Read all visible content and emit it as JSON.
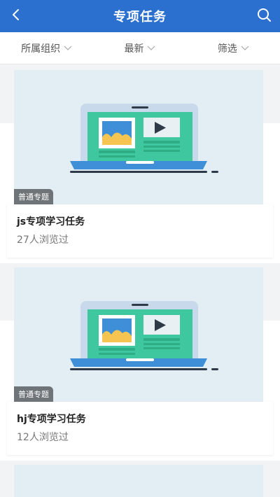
{
  "header": {
    "title": "专项任务",
    "back_icon": "chevron-left-icon",
    "search_icon": "search-icon",
    "bg": "#2b6fcf"
  },
  "filters": [
    {
      "label": "所属组织",
      "icon": "chevron-down-icon"
    },
    {
      "label": "最新",
      "icon": "chevron-down-icon"
    },
    {
      "label": "筛选",
      "icon": "chevron-down-icon"
    }
  ],
  "cards": [
    {
      "tag": "普通专题",
      "title": "js专项学习任务",
      "views": "27",
      "views_suffix": "人浏览过"
    },
    {
      "tag": "普通专题",
      "title": "hj专项学习任务",
      "views": "12",
      "views_suffix": "人浏览过"
    }
  ]
}
